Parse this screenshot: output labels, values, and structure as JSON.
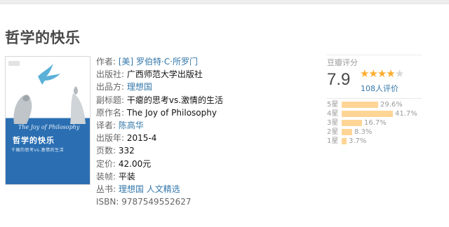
{
  "book": {
    "title": "哲学的快乐",
    "cover": {
      "en_title": "The Joy of Philosophy",
      "zh_title": "哲学的快乐",
      "subtitle": "千瘾的思考vs.激情的生活"
    },
    "info": [
      {
        "label": "作者:",
        "value": "[美] 罗伯特·C·所罗门",
        "link": true
      },
      {
        "label": "出版社:",
        "value": "广西师范大学出版社",
        "link": false
      },
      {
        "label": "出品方:",
        "value": "理想国",
        "link": true
      },
      {
        "label": "副标题:",
        "value": "干瘪的思考vs.激情的生活",
        "link": false
      },
      {
        "label": "原作名:",
        "value": "The Joy of Philosophy",
        "link": false
      },
      {
        "label": "译者:",
        "value": "陈高华",
        "link": true
      },
      {
        "label": "出版年:",
        "value": "2015-4",
        "link": false
      },
      {
        "label": "页数:",
        "value": "332",
        "link": false
      },
      {
        "label": "定价:",
        "value": "42.00元",
        "link": false
      },
      {
        "label": "装帧:",
        "value": "平装",
        "link": false
      },
      {
        "label": "丛书:",
        "value": "理想国 人文精选",
        "link": true
      },
      {
        "label": "ISBN:",
        "value": "9787549552627",
        "link": false
      }
    ]
  },
  "rating": {
    "header": "豆瓣评分",
    "score": "7.9",
    "stars_filled": 4,
    "stars_total": 5,
    "votes": "108人评价",
    "star_color": "#ffac2d",
    "bar_color": "#ffd596",
    "distribution": [
      {
        "label": "5星",
        "percent": "29.6%",
        "value": 29.6
      },
      {
        "label": "4星",
        "percent": "41.7%",
        "value": 41.7
      },
      {
        "label": "3星",
        "percent": "16.7%",
        "value": 16.7
      },
      {
        "label": "2星",
        "percent": "8.3%",
        "value": 8.3
      },
      {
        "label": "1星",
        "percent": "3.7%",
        "value": 3.7
      }
    ]
  },
  "colors": {
    "link": "#3377aa",
    "label": "#666666",
    "title": "#494949"
  }
}
